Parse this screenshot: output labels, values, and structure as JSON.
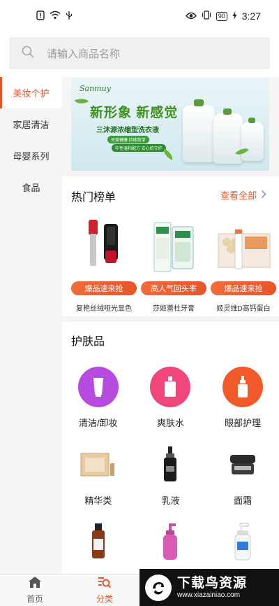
{
  "status_bar": {
    "time": "3:27",
    "battery": "90"
  },
  "search": {
    "placeholder": "请输入商品名称"
  },
  "sidebar": {
    "items": [
      {
        "label": "美妆个护",
        "active": true
      },
      {
        "label": "家居清洁",
        "active": false
      },
      {
        "label": "母婴系列",
        "active": false
      },
      {
        "label": "食品",
        "active": false
      }
    ]
  },
  "banner": {
    "brand": "Sanmuy",
    "headline": "新形象  新感觉",
    "subtitle": "三沐源浓缩型洗衣液",
    "tag1": "关爱健康  持续简单",
    "tag2": "中性温和配方  安心的守护"
  },
  "hot_list": {
    "title": "热门榜单",
    "view_all": "查看全部",
    "products": [
      {
        "badge": "爆品速来抢",
        "name": "复艳丝绒哑光显色"
      },
      {
        "badge": "高人气回头率",
        "name": "莎姬蕾杜牙膏"
      },
      {
        "badge": "爆品速来抢",
        "name": "姬灵维D高钙蛋白"
      }
    ]
  },
  "skincare": {
    "title": "护肤品",
    "categories": [
      {
        "label": "清洁/卸妆",
        "color": "#b74be0"
      },
      {
        "label": "爽肤水",
        "color": "#f0477a"
      },
      {
        "label": "眼部护理",
        "color": "#f25a2c"
      },
      {
        "label": "精华类",
        "color": ""
      },
      {
        "label": "乳液",
        "color": ""
      },
      {
        "label": "面霜",
        "color": ""
      },
      {
        "label": "",
        "color": ""
      },
      {
        "label": "",
        "color": ""
      },
      {
        "label": "",
        "color": ""
      }
    ]
  },
  "tab_bar": {
    "tabs": [
      {
        "label": "首页",
        "icon": "home-icon",
        "active": false
      },
      {
        "label": "分类",
        "icon": "category-search-icon",
        "active": true
      }
    ]
  },
  "watermark": {
    "title": "下载鸟资源",
    "url": "www.xiazainiao.com"
  },
  "colors": {
    "accent": "#e8542a",
    "sidebar_bg": "#f5f5f5"
  }
}
